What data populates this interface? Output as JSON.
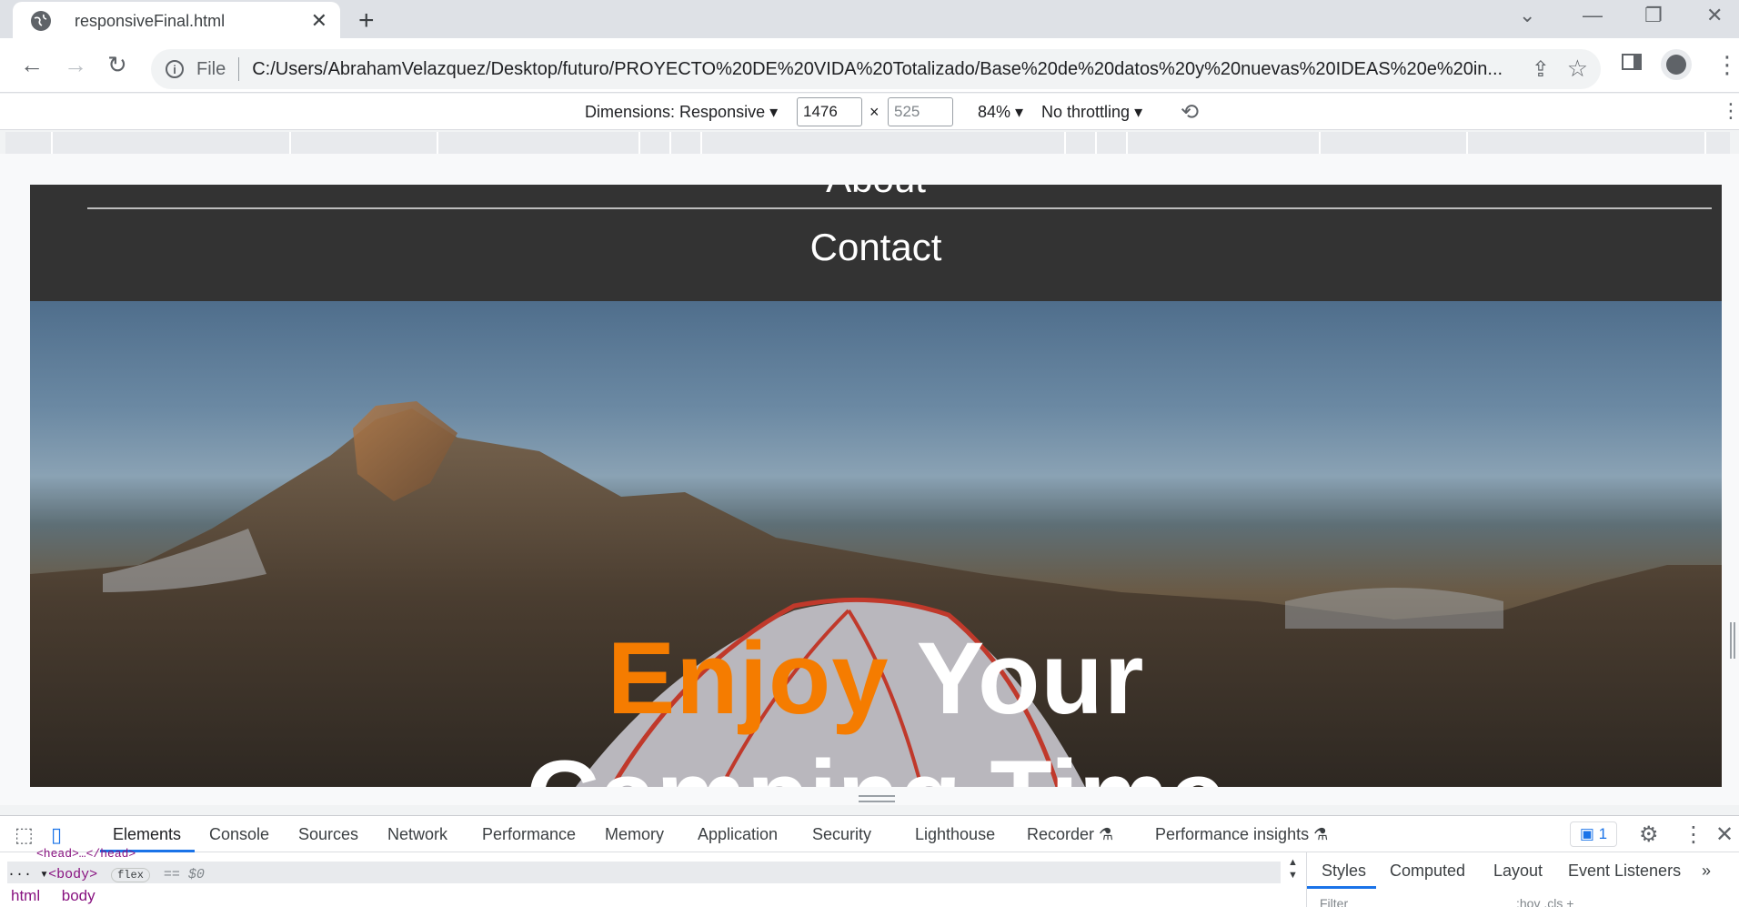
{
  "browser": {
    "tab": {
      "title": "responsiveFinal.html"
    },
    "new_tab_icon": "plus-icon",
    "address_bar": {
      "scheme_label": "File",
      "url": "C:/Users/AbrahamVelazquez/Desktop/futuro/PROYECTO%20DE%20VIDA%20Totalizado/Base%20de%20datos%20y%20nuevas%20IDEAS%20e%20in..."
    }
  },
  "device_toolbar": {
    "dimensions_label": "Dimensions: Responsive",
    "width": "1476",
    "times": "×",
    "height_placeholder": "525",
    "zoom": "84%",
    "throttling": "No throttling"
  },
  "site": {
    "menu": {
      "about": "About",
      "contact": "Contact"
    },
    "hero": {
      "word1": "Enjoy",
      "word2": "Your",
      "line2": "Camping Time"
    },
    "colors": {
      "accent": "#f57c00",
      "menu_bg": "#333333"
    }
  },
  "devtools": {
    "tabs": [
      "Elements",
      "Console",
      "Sources",
      "Network",
      "Performance",
      "Memory",
      "Application",
      "Security",
      "Lighthouse",
      "Recorder",
      "Performance insights"
    ],
    "issues_count": "1",
    "elements": {
      "head_line": "<head>…</head>",
      "dots": "···",
      "body_tag": "<body>",
      "flex_badge": "flex",
      "eq": "== $0"
    },
    "breadcrumbs": [
      "html",
      "body"
    ],
    "side_tabs": [
      "Styles",
      "Computed",
      "Layout",
      "Event Listeners"
    ],
    "more": "»",
    "filter_placeholder": "Filter",
    "filter_suffix": ":hov .cls +"
  }
}
